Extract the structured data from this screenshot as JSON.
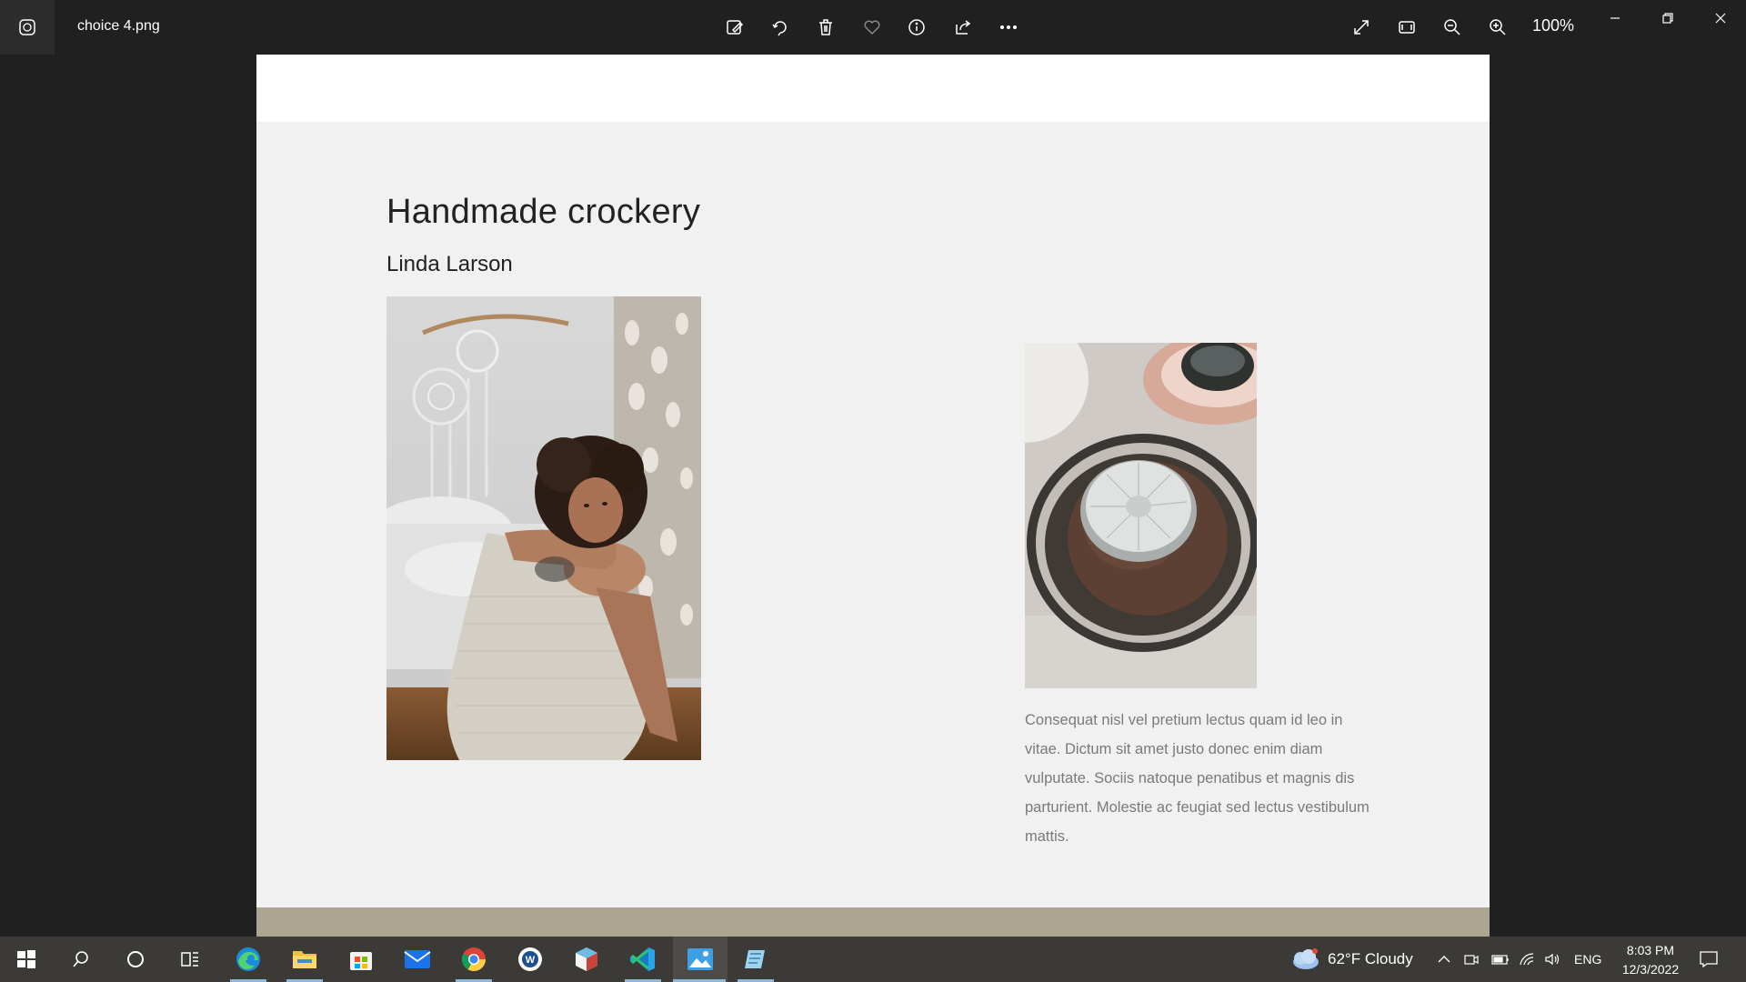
{
  "titlebar": {
    "filename": "choice 4.png",
    "zoom": "100%",
    "icons": [
      "photos-app-icon",
      "edit-image-icon",
      "rotate-icon",
      "delete-icon",
      "favorite-icon",
      "info-icon",
      "share-icon",
      "more-icon",
      "fullscreen-icon",
      "fit-icon",
      "zoom-out-icon",
      "zoom-in-icon",
      "minimize-icon",
      "restore-icon",
      "close-icon"
    ]
  },
  "image": {
    "headline": "Handmade crockery",
    "author": "Linda Larson",
    "body": "Consequat nisl vel pretium lectus quam id leo in vitae. Dictum sit amet justo donec enim diam vulputate. Sociis natoque penatibus et magnis dis parturient. Molestie ac feugiat sed lectus vestibulum mattis.",
    "footer_color": "#aca591",
    "background_color": "#f1f1f1"
  },
  "taskbar": {
    "apps": [
      "start",
      "search",
      "cortana",
      "task-view",
      "edge",
      "file-explorer",
      "microsoft-store",
      "mail",
      "chrome",
      "app-w",
      "app-cube",
      "vscode",
      "photos",
      "app-notes"
    ],
    "weather": "62°F  Cloudy",
    "language": "ENG",
    "time": "8:03 PM",
    "date": "12/3/2022"
  }
}
